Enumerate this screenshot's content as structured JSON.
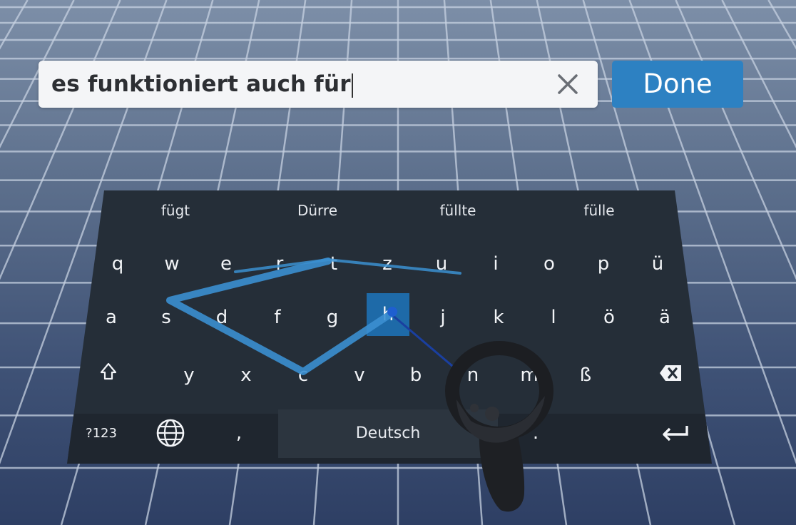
{
  "text_field": {
    "value": "es funktioniert auch für"
  },
  "done_button": {
    "label": "Done"
  },
  "suggestions": [
    "fügt",
    "Dürre",
    "füllte",
    "fülle"
  ],
  "keyboard": {
    "row1": [
      "q",
      "w",
      "e",
      "r",
      "t",
      "z",
      "u",
      "i",
      "o",
      "p",
      "ü"
    ],
    "row2": [
      "a",
      "s",
      "d",
      "f",
      "g",
      "h",
      "j",
      "k",
      "l",
      "ö",
      "ä"
    ],
    "row3": [
      "y",
      "x",
      "c",
      "v",
      "b",
      "n",
      "m",
      "ß"
    ],
    "active_key": "h",
    "symbols_label": "?123",
    "comma_label": ",",
    "space_label": "Deutsch",
    "period_label": "."
  },
  "icons": {
    "clear": "close-icon",
    "shift": "shift-icon",
    "backspace": "backspace-icon",
    "language": "globe-icon",
    "enter": "enter-icon",
    "controller": "vr-controller"
  },
  "colors": {
    "accent": "#2d81c2",
    "keyboard_bg": "#252e38",
    "swipe_trail": "#3b8fd0",
    "active_key": "#1e6aa8"
  }
}
